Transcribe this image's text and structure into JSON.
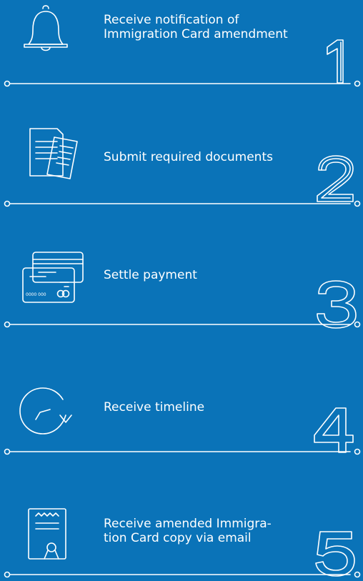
{
  "steps": [
    {
      "number": "1",
      "label": "Receive notification of\nImmigration Card amendment",
      "icon": "bell-icon"
    },
    {
      "number": "2",
      "label": "Submit required documents",
      "icon": "documents-icon"
    },
    {
      "number": "3",
      "label": "Settle payment",
      "icon": "credit-cards-icon"
    },
    {
      "number": "4",
      "label": "Receive timeline",
      "icon": "clock-refresh-icon"
    },
    {
      "number": "5",
      "label": "Receive amended Immigra-\ntion Card copy via email",
      "icon": "certificate-icon"
    }
  ],
  "card_text": "0000 000",
  "colors": {
    "background": "#0a73b8",
    "foreground": "#ffffff"
  }
}
